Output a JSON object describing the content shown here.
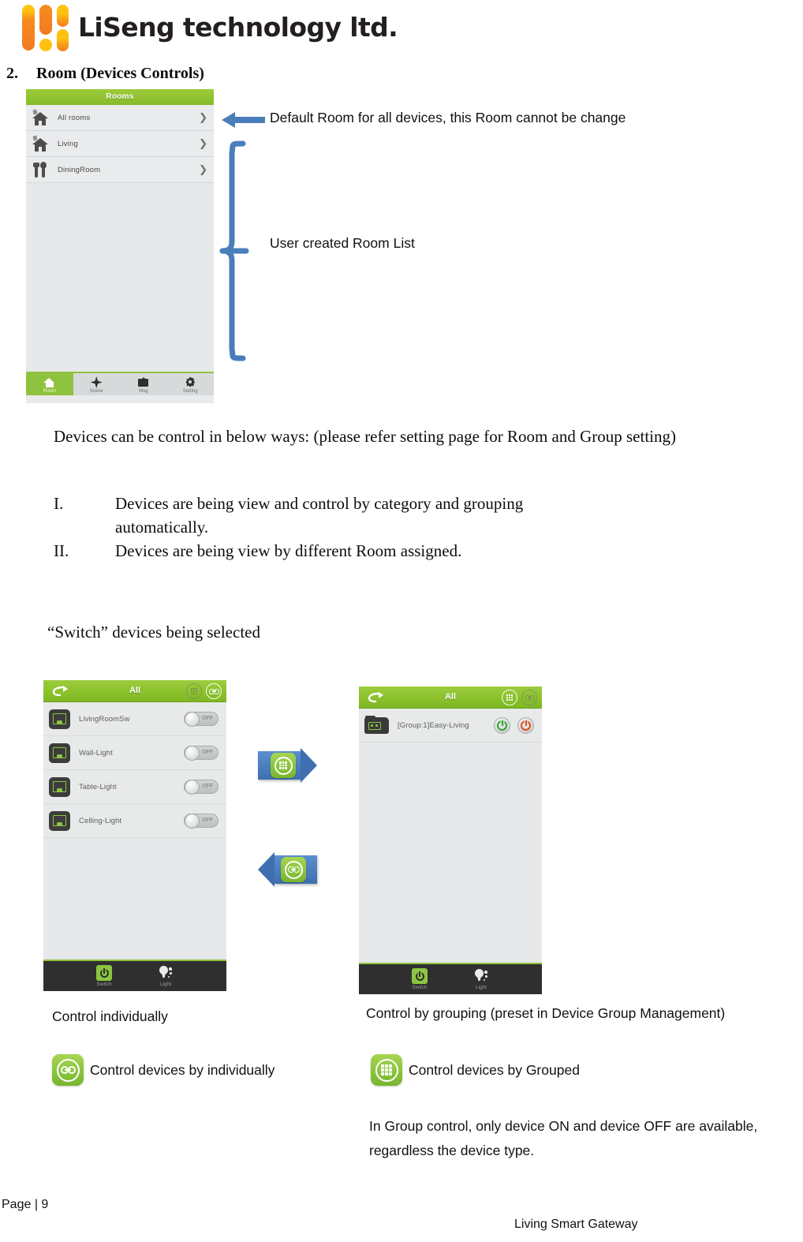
{
  "header": {
    "brand": "LiSeng technology ltd.",
    "logo_colors": {
      "orange": "#f47920",
      "yellow": "#ffc20e"
    }
  },
  "section": {
    "number": "2.",
    "title": "Room (Devices Controls)"
  },
  "rooms_phone": {
    "title": "Rooms",
    "rows": [
      {
        "label": "All rooms",
        "icon": "house-icon",
        "chevron": "❯"
      },
      {
        "label": "Living",
        "icon": "house-icon",
        "chevron": "❯"
      },
      {
        "label": "DiningRoom",
        "icon": "fork-spoon-icon",
        "chevron": "❯"
      }
    ],
    "tabs": [
      {
        "label": "Room",
        "icon": "home-icon",
        "active": true
      },
      {
        "label": "Scene",
        "icon": "scene-diamond-icon",
        "active": false
      },
      {
        "label": "Msg",
        "icon": "envelope-icon",
        "active": false
      },
      {
        "label": "Setting",
        "icon": "gear-icon",
        "active": false
      }
    ]
  },
  "annotations": {
    "default_room": "Default Room for all devices, this Room cannot be change",
    "user_rooms": "User created Room List"
  },
  "body": {
    "intro": "Devices can be control in below ways: (please refer setting page for Room and Group setting)",
    "list": [
      {
        "marker": "I.",
        "text": "Devices are being view and control by category and grouping automatically."
      },
      {
        "marker": "II.",
        "text": "Devices are being view by different Room assigned."
      }
    ],
    "switch_heading": "“Switch” devices being selected"
  },
  "individual_phone": {
    "header_title": "All",
    "back_icon": "back-arrow-icon",
    "grid_button": "grid-view-icon",
    "link_button": "link-view-icon",
    "active_button": "link-view-icon",
    "devices": [
      {
        "name": "LivingRoomSw",
        "state": "OFF"
      },
      {
        "name": "Wall-Light",
        "state": "OFF"
      },
      {
        "name": "Table-Light",
        "state": "OFF"
      },
      {
        "name": "Celling-Light",
        "state": "OFF"
      }
    ],
    "tabs": [
      {
        "label": "Switch",
        "icon": "power-icon",
        "active": true
      },
      {
        "label": "Light",
        "icon": "bulb-icon",
        "active": false
      }
    ]
  },
  "group_phone": {
    "header_title": "All",
    "back_icon": "back-arrow-icon",
    "grid_button": "grid-view-icon",
    "link_button": "link-view-icon",
    "active_button": "grid-view-icon",
    "groups": [
      {
        "name": "[Group:1]Easy-Living",
        "on_label": "ON",
        "off_label": "OFF"
      }
    ],
    "tabs": [
      {
        "label": "Switch",
        "icon": "power-icon",
        "active": true
      },
      {
        "label": "Light",
        "icon": "bulb-icon",
        "active": false
      }
    ]
  },
  "callouts": {
    "to_group": "grid-view-icon",
    "to_individual": "link-view-icon"
  },
  "captions": {
    "individual_title": "Control individually",
    "group_title": "Control by grouping (preset in Device Group Management)",
    "individual_legend": "Control devices by individually",
    "group_legend": "Control devices by Grouped",
    "group_note": "In Group control, only device ON and device OFF are available, regardless the device type."
  },
  "footer": {
    "page": "Page | 9",
    "product": "Living Smart Gateway"
  }
}
